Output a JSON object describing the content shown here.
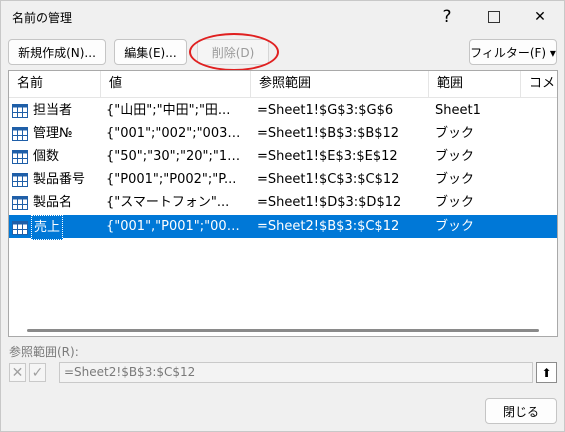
{
  "dialog": {
    "title": "名前の管理",
    "help_glyph": "?",
    "close_glyph": "✕"
  },
  "toolbar": {
    "new_label": "新規作成(N)...",
    "edit_label": "編集(E)...",
    "delete_label": "削除(D)",
    "filter_label": "フィルター(F) ▾"
  },
  "list": {
    "headers": [
      "名前",
      "値",
      "参照範囲",
      "範囲",
      "コメ"
    ],
    "rows": [
      {
        "name": "担当者",
        "value": "{\"山田\";\"中田\";\"田...",
        "ref": "=Sheet1!$G$3:$G$6",
        "scope": "Sheet1"
      },
      {
        "name": "管理№",
        "value": "{\"001\";\"002\";\"003\";...",
        "ref": "=Sheet1!$B$3:$B$12",
        "scope": "ブック"
      },
      {
        "name": "個数",
        "value": "{\"50\";\"30\";\"20\";\"10...",
        "ref": "=Sheet1!$E$3:$E$12",
        "scope": "ブック"
      },
      {
        "name": "製品番号",
        "value": "{\"P001\";\"P002\";\"P...",
        "ref": "=Sheet1!$C$3:$C$12",
        "scope": "ブック"
      },
      {
        "name": "製品名",
        "value": "{\"スマートフォン\"...",
        "ref": "=Sheet1!$D$3:$D$12",
        "scope": "ブック"
      },
      {
        "name": "売上",
        "value": "{\"001\",\"P001\";\"002...",
        "ref": "=Sheet2!$B$3:$C$12",
        "scope": "ブック"
      }
    ],
    "selected_index": 5
  },
  "reference": {
    "label": "参照範囲(R):",
    "value": "=Sheet2!$B$3:$C$12",
    "cancel_glyph": "✕",
    "confirm_glyph": "✓",
    "collapse_glyph": "⬆"
  },
  "footer": {
    "close_label": "閉じる"
  },
  "colors": {
    "selection": "#0078d7",
    "annotation_ring": "#e02020"
  }
}
